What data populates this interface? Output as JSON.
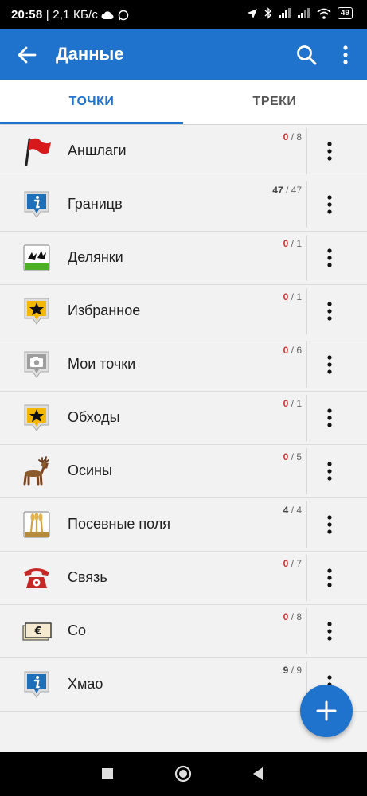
{
  "status_bar": {
    "time": "20:58",
    "speed": "| 2,1 КБ/с",
    "battery": "49"
  },
  "app_bar": {
    "title": "Данные"
  },
  "tabs": [
    {
      "label": "ТОЧКИ"
    },
    {
      "label": "ТРЕКИ"
    }
  ],
  "items": [
    {
      "label": "Аншлаги",
      "visible": "0",
      "total": "/ 8",
      "icon": "red-flag-icon"
    },
    {
      "label": "Границв",
      "visible": "47",
      "total": "/ 47",
      "icon": "info-marker-icon"
    },
    {
      "label": "Делянки",
      "visible": "0",
      "total": "/ 1",
      "icon": "birds-landscape-icon"
    },
    {
      "label": "Избранное",
      "visible": "0",
      "total": "/ 1",
      "icon": "star-marker-icon"
    },
    {
      "label": "Мои точки",
      "visible": "0",
      "total": "/ 6",
      "icon": "camera-marker-icon"
    },
    {
      "label": "Обходы",
      "visible": "0",
      "total": "/ 1",
      "icon": "star-marker-icon"
    },
    {
      "label": "Осины",
      "visible": "0",
      "total": "/ 5",
      "icon": "deer-icon"
    },
    {
      "label": "Посевные поля",
      "visible": "4",
      "total": "/ 4",
      "icon": "wheat-field-icon"
    },
    {
      "label": "Связь",
      "visible": "0",
      "total": "/ 7",
      "icon": "telephone-icon"
    },
    {
      "label": "Со",
      "visible": "0",
      "total": "/ 8",
      "icon": "euro-banknote-icon"
    },
    {
      "label": "Хмао",
      "visible": "9",
      "total": "/ 9",
      "icon": "info-marker-icon"
    }
  ],
  "colors": {
    "primary": "#1f73cc",
    "count_hidden": "#d32f2f",
    "count_visible": "#444444"
  }
}
